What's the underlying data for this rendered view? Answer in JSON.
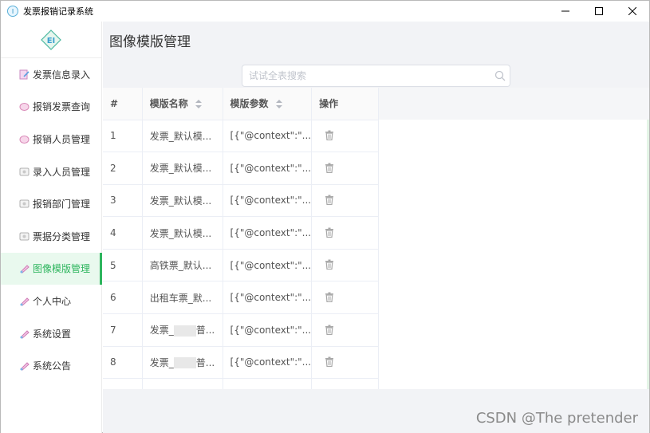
{
  "window": {
    "title": "发票报销记录系统",
    "icon_text": "I",
    "controls": [
      "minimize-icon",
      "maximize-icon",
      "close-icon"
    ]
  },
  "sidebar": {
    "logo_text": "EI",
    "items": [
      {
        "label": "发票信息录入",
        "icon": "invoice-entry-icon"
      },
      {
        "label": "报销发票查询",
        "icon": "invoice-query-icon"
      },
      {
        "label": "报销人员管理",
        "icon": "reimburser-icon"
      },
      {
        "label": "录入人员管理",
        "icon": "entry-staff-icon"
      },
      {
        "label": "报销部门管理",
        "icon": "department-icon"
      },
      {
        "label": "票据分类管理",
        "icon": "category-icon"
      },
      {
        "label": "图像模版管理",
        "icon": "template-icon",
        "active": true
      },
      {
        "label": "个人中心",
        "icon": "profile-icon"
      },
      {
        "label": "系统设置",
        "icon": "settings-icon"
      },
      {
        "label": "系统公告",
        "icon": "announcement-icon"
      }
    ]
  },
  "main": {
    "title": "图像模版管理",
    "search": {
      "placeholder": "试试全表搜索",
      "value": ""
    },
    "table": {
      "headers": {
        "index": "#",
        "name": "模版名称",
        "params": "模版参数",
        "ops": "操作"
      },
      "rows": [
        {
          "index": "1",
          "name": "发票_默认模...",
          "params": "[{\"@context\":\"..."
        },
        {
          "index": "2",
          "name": "发票_默认模...",
          "params": "[{\"@context\":\"..."
        },
        {
          "index": "3",
          "name": "发票_默认模...",
          "params": "[{\"@context\":\"..."
        },
        {
          "index": "4",
          "name": "发票_默认模...",
          "params": "[{\"@context\":\"..."
        },
        {
          "index": "5",
          "name": "高铁票_默认...",
          "params": "[{\"@context\":\"..."
        },
        {
          "index": "6",
          "name": "出租车票_默...",
          "params": "[{\"@context\":\"..."
        },
        {
          "index": "7",
          "name_prefix": "发票_",
          "name_suffix": "普...",
          "params": "[{\"@context\":\"..."
        },
        {
          "index": "8",
          "name_prefix": "发票_",
          "name_suffix": "普...",
          "params": "[{\"@context\":\"..."
        }
      ]
    }
  },
  "watermark": "CSDN @The  pretender",
  "colors": {
    "accent": "#2db55d",
    "active_bg": "#e9f9ee",
    "main_bg": "#f2f3f6"
  }
}
